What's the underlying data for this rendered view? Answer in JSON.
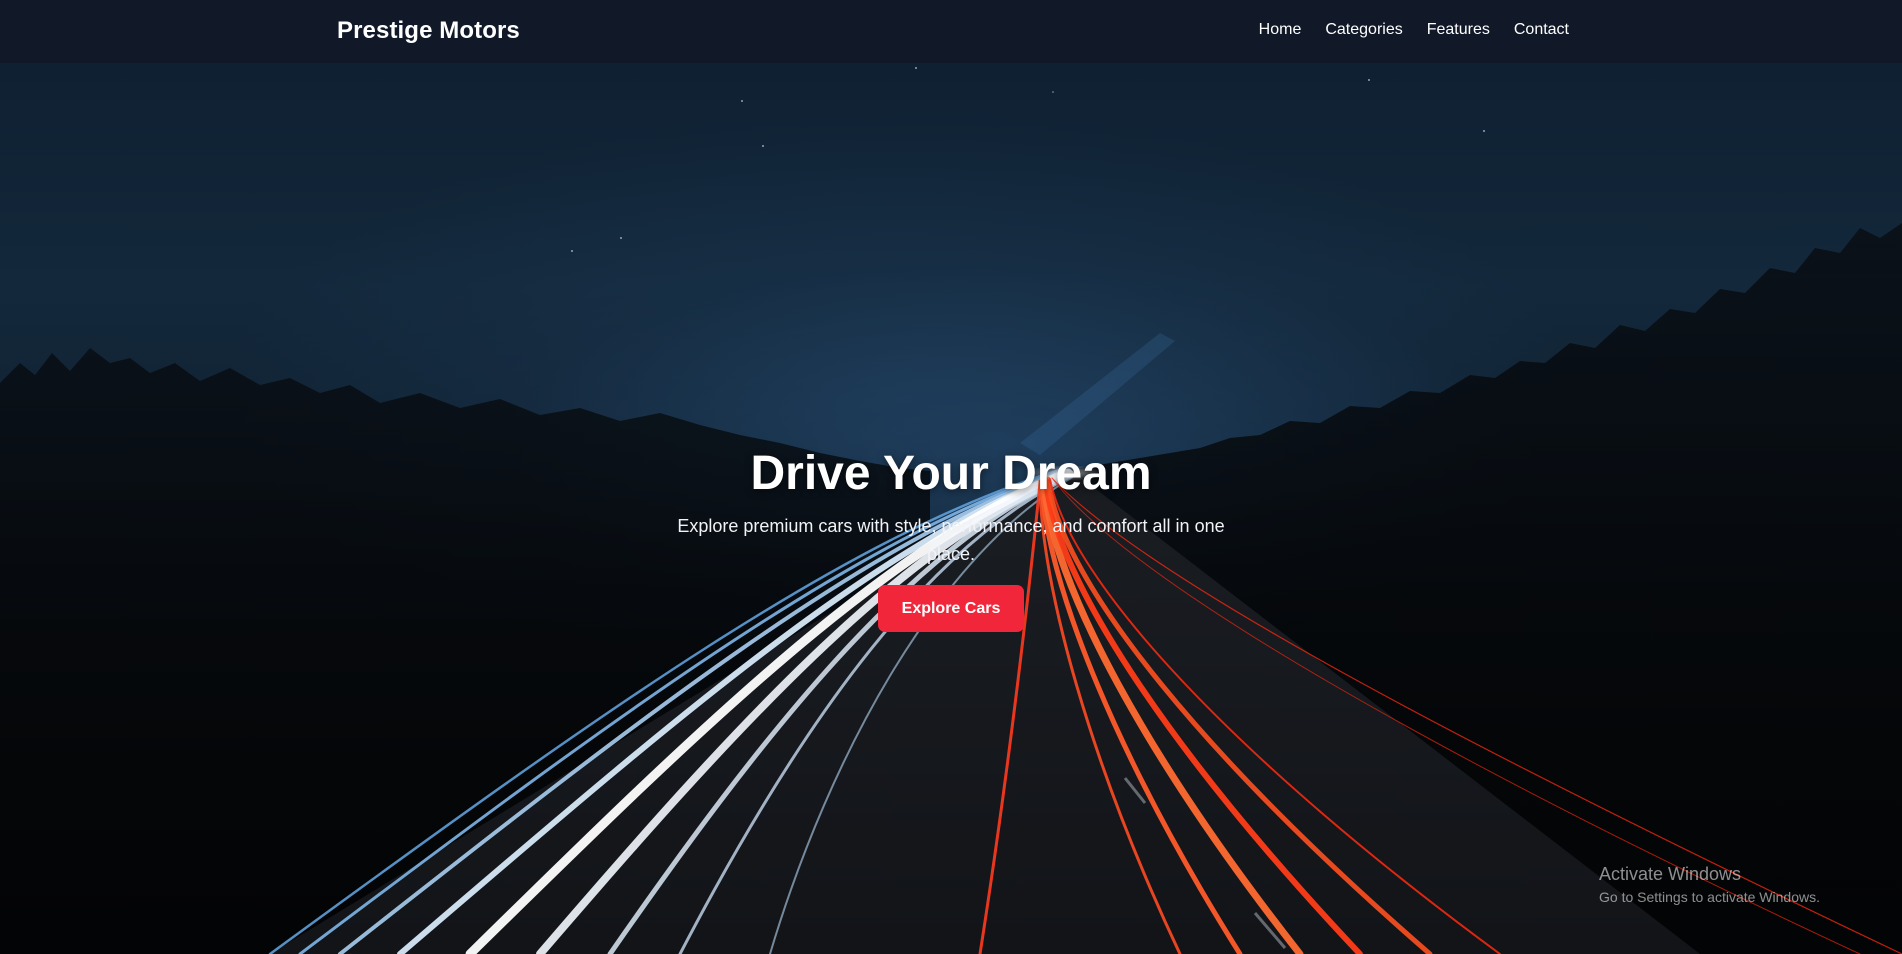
{
  "navbar": {
    "brand": "Prestige Motors",
    "links": [
      "Home",
      "Categories",
      "Features",
      "Contact"
    ]
  },
  "hero": {
    "title": "Drive Your Dream",
    "subtitle": "Explore premium cars with style, performance, and comfort all in one place.",
    "button_label": "Explore Cars",
    "accent_color": "#f1263a",
    "background": "night highway with light trails"
  },
  "watermark": {
    "title": "Activate Windows",
    "subtitle": "Go to Settings to activate Windows."
  }
}
